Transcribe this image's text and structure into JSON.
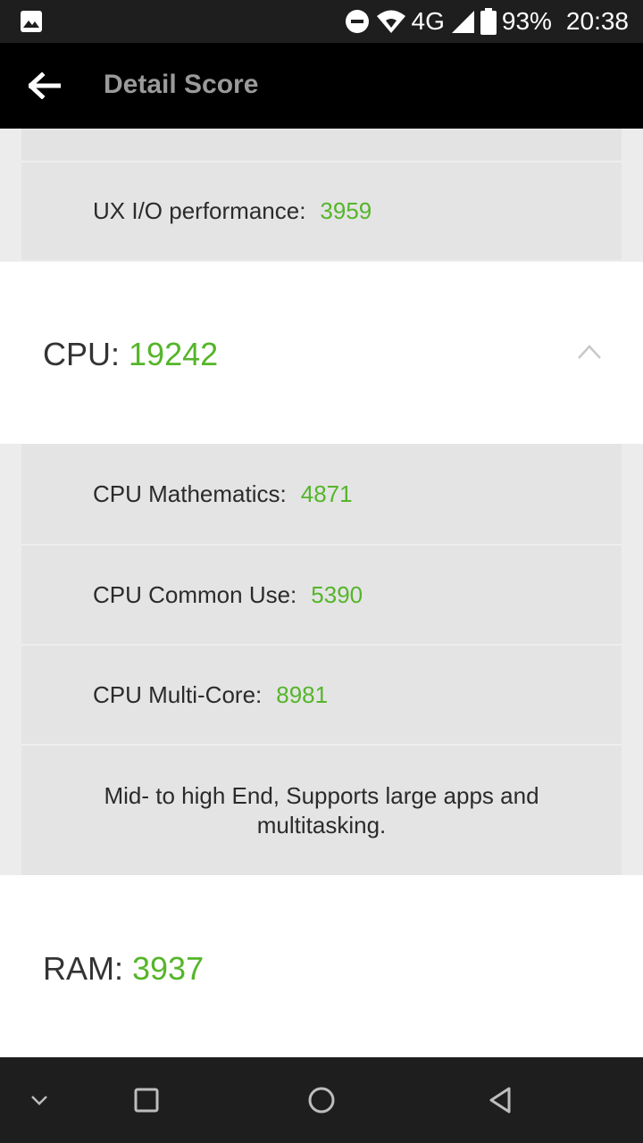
{
  "status_bar": {
    "network": "4G",
    "battery": "93%",
    "time": "20:38",
    "icons": [
      "gallery-icon",
      "dnd-icon",
      "wifi-icon",
      "signal-icon",
      "battery-icon"
    ]
  },
  "app_bar": {
    "title": "Detail Score",
    "back_icon": "arrow-left-icon"
  },
  "ux_section": {
    "rows": [
      {
        "label": "UX I/O performance:",
        "value": "3959"
      }
    ]
  },
  "cpu_section": {
    "label": "CPU:",
    "score": "19242",
    "expanded": true,
    "rows": [
      {
        "label": "CPU Mathematics:",
        "value": "4871"
      },
      {
        "label": "CPU Common Use:",
        "value": "5390"
      },
      {
        "label": "CPU Multi-Core:",
        "value": "8981"
      }
    ],
    "description": "Mid- to high End, Supports large apps and multitasking."
  },
  "ram_section": {
    "label": "RAM:",
    "score": "3937"
  },
  "nav_bar": {
    "icons": [
      "chevron-down-icon",
      "recents-icon",
      "home-icon",
      "back-icon"
    ]
  },
  "colors": {
    "accent": "#55b52a",
    "app_bar": "#000000",
    "title": "#9a9a9a",
    "row_bg": "#e4e4e4"
  }
}
